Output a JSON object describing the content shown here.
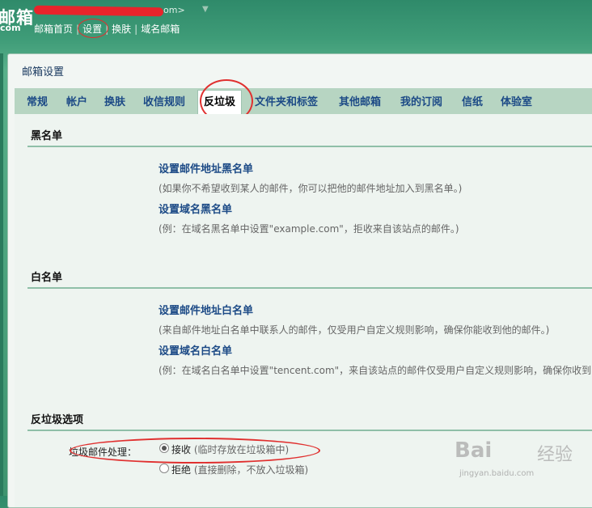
{
  "header": {
    "logo_text": "邮箱",
    "logo_sub": "com",
    "account_suffix": "om>",
    "account_arrow": "▼",
    "nav": [
      {
        "label": "邮箱首页"
      },
      {
        "label": "设置"
      },
      {
        "label": "换肤"
      },
      {
        "label": "域名邮箱"
      }
    ],
    "nav_sep": "|"
  },
  "panel": {
    "title": "邮箱设置",
    "tabs": [
      {
        "label": "常规"
      },
      {
        "label": "帐户"
      },
      {
        "label": "换肤"
      },
      {
        "label": "收信规则"
      },
      {
        "label": "反垃圾"
      },
      {
        "label": "文件夹和标签"
      },
      {
        "label": "其他邮箱"
      },
      {
        "label": "我的订阅"
      },
      {
        "label": "信纸"
      },
      {
        "label": "体验室"
      }
    ],
    "active_tab": "反垃圾"
  },
  "blacklist": {
    "title": "黑名单",
    "address_link": "设置邮件地址黑名单",
    "address_desc": "(如果你不希望收到某人的邮件，你可以把他的邮件地址加入到黑名单。)",
    "domain_link": "设置域名黑名单",
    "domain_desc": "(例：在域名黑名单中设置\"example.com\"，拒收来自该站点的邮件。)"
  },
  "whitelist": {
    "title": "白名单",
    "address_link": "设置邮件地址白名单",
    "address_desc": "(来自邮件地址白名单中联系人的邮件，仅受用户自定义规则影响，确保你能收到他的邮件。)",
    "domain_link": "设置域名白名单",
    "domain_desc": "(例：在域名白名单中设置\"tencent.com\"，来自该站点的邮件仅受用户自定义规则影响，确保你收到"
  },
  "antispam": {
    "title": "反垃圾选项",
    "label": "垃圾邮件处理：",
    "options": [
      {
        "label": "接收",
        "note": "(临时存放在垃圾箱中)",
        "checked": true
      },
      {
        "label": "拒绝",
        "note": "(直接删除，不放入垃圾箱)",
        "checked": false
      }
    ]
  },
  "watermark": {
    "brand": "Bai",
    "brand2": "经验",
    "url": "jingyan.baidu.com"
  },
  "colors": {
    "accent_green": "#3f9c78",
    "link_blue": "#1c4a86",
    "annotation_red": "#e0302f"
  }
}
